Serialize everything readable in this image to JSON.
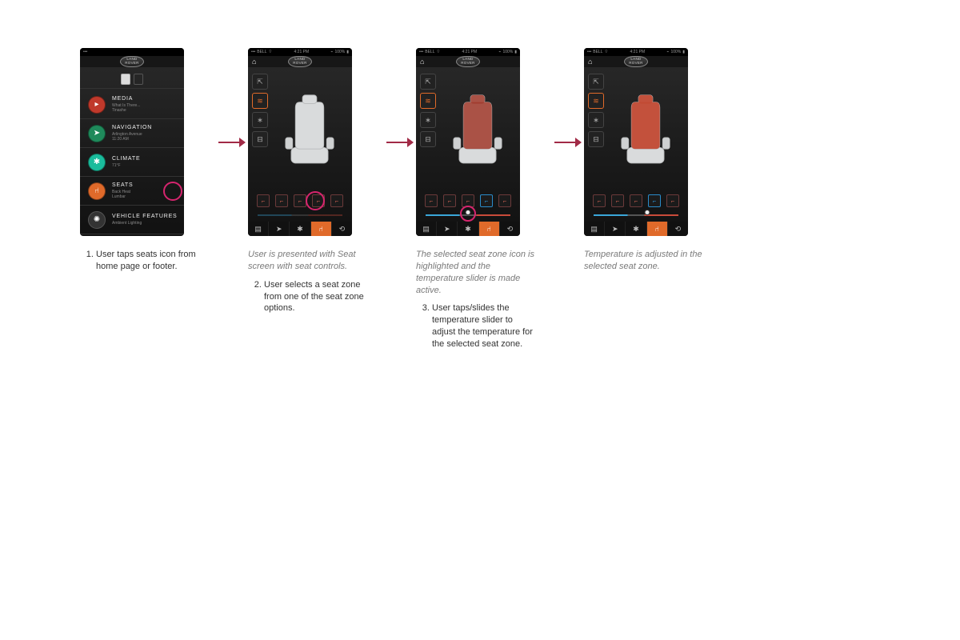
{
  "phone_status": {
    "carrier": "BELL",
    "time": "4:21 PM",
    "battery": "100%"
  },
  "brand": "LAND\nROVER",
  "home_menu": {
    "media": {
      "title": "MEDIA",
      "sub1": "What Is There...",
      "sub2": "Tinashe"
    },
    "nav": {
      "title": "NAVIGATION",
      "sub1": "Arlington Avenue",
      "sub2": "11:20 AM"
    },
    "climate": {
      "title": "CLIMATE",
      "sub1": "71°F"
    },
    "seats": {
      "title": "SEATS",
      "sub1": "Back Heat",
      "sub2": "Lumbar"
    },
    "vf": {
      "title": "VEHICLE FEATURES",
      "sub1": "Ambient Lighting"
    }
  },
  "seat_col_icons": [
    "link",
    "heat",
    "fan",
    "lumbar"
  ],
  "seat_zones": [
    "zone-a",
    "zone-b",
    "zone-c",
    "zone-d",
    "zone-e"
  ],
  "tabbar_icons": [
    "car",
    "nav",
    "fan",
    "seat",
    "audio"
  ],
  "captions": {
    "step1_num": "1.",
    "step1_text": "User taps seats icon from home page or footer.",
    "step2_intro": "User is presented with Seat screen with seat controls.",
    "step2_num": "2.",
    "step2_text": "User selects a seat zone from one of the seat zone options.",
    "step3_intro": "The selected seat zone icon is highlighted and the temperature slider is made active.",
    "step3_num": "3.",
    "step3_text": "User taps/slides the temperature slider to adjust the temperature for the selected seat zone.",
    "step4_intro": "Temperature is adjusted in the selected seat zone."
  }
}
